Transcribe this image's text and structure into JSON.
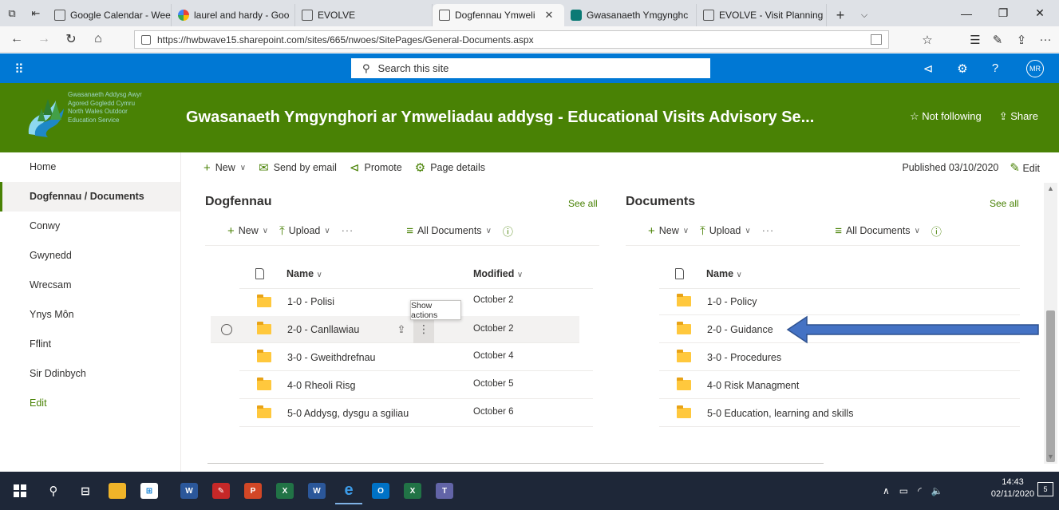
{
  "browser": {
    "tabs": [
      {
        "title": "Google Calendar - Wee",
        "active": false,
        "favicon": "calendar-icon"
      },
      {
        "title": "laurel and hardy - Goo",
        "active": false,
        "favicon": "google-icon"
      },
      {
        "title": "EVOLVE",
        "active": false,
        "favicon": "page-icon"
      },
      {
        "title": "Dogfennau Ymweli",
        "active": true,
        "favicon": "page-icon"
      },
      {
        "title": "Gwasanaeth Ymgynghc",
        "active": false,
        "favicon": "sharepoint-icon"
      },
      {
        "title": "EVOLVE - Visit Planning",
        "active": false,
        "favicon": "page-icon"
      }
    ],
    "url": "https://hwbwave15.sharepoint.com/sites/665/nwoes/SitePages/General-Documents.aspx"
  },
  "suite": {
    "search_placeholder": "Search this site",
    "avatar_initials": "MR"
  },
  "site": {
    "logo_text": [
      "Gwasanaeth Addysg Awyr",
      "Agored Gogledd Cymru",
      "North Wales Outdoor",
      "Education Service"
    ],
    "title": "Gwasanaeth Ymgynghori ar Ymweliadau addysg - Educational Visits Advisory Se...",
    "follow_label": "Not following",
    "share_label": "Share"
  },
  "leftnav": {
    "items": [
      {
        "label": "Home"
      },
      {
        "label": "Dogfennau / Documents",
        "selected": true
      },
      {
        "label": "Conwy"
      },
      {
        "label": "Gwynedd"
      },
      {
        "label": "Wrecsam"
      },
      {
        "label": "Ynys Môn"
      },
      {
        "label": "Fflint"
      },
      {
        "label": "Sir Ddinbych"
      }
    ],
    "edit_label": "Edit"
  },
  "commandbar": {
    "new_label": "New",
    "email_label": "Send by email",
    "promote_label": "Promote",
    "details_label": "Page details",
    "published_label": "Published 03/10/2020",
    "edit_label": "Edit"
  },
  "library_left": {
    "title": "Dogfennau",
    "see_all": "See all",
    "new_label": "New",
    "upload_label": "Upload",
    "more": "···",
    "view_label": "All Documents",
    "col_name": "Name",
    "col_modified": "Modified",
    "rows": [
      {
        "name": "1-0 - Polisi",
        "modified": "October 2"
      },
      {
        "name": "2-0 - Canllawiau",
        "modified": "October 2"
      },
      {
        "name": "3-0 - Gweithdrefnau",
        "modified": "October 4"
      },
      {
        "name": "4-0 Rheoli Risg",
        "modified": "October 5"
      },
      {
        "name": "5-0 Addysg, dysgu a sgiliau",
        "modified": "October 6"
      }
    ],
    "tooltip": "Show actions"
  },
  "library_right": {
    "title": "Documents",
    "see_all": "See all",
    "new_label": "New",
    "upload_label": "Upload",
    "more": "···",
    "view_label": "All Documents",
    "col_name": "Name",
    "rows": [
      {
        "name": "1-0 - Policy"
      },
      {
        "name": "2-0 - Guidance"
      },
      {
        "name": "3-0 - Procedures"
      },
      {
        "name": "4-0 Risk Managment"
      },
      {
        "name": "5-0 Education, learning and skills"
      }
    ]
  },
  "taskbar": {
    "clock_time": "14:43",
    "clock_date": "02/11/2020",
    "notifications": "5"
  },
  "colors": {
    "brand_green": "#498205",
    "suite_blue": "#0078d4",
    "arrow_blue": "#4472c4"
  }
}
